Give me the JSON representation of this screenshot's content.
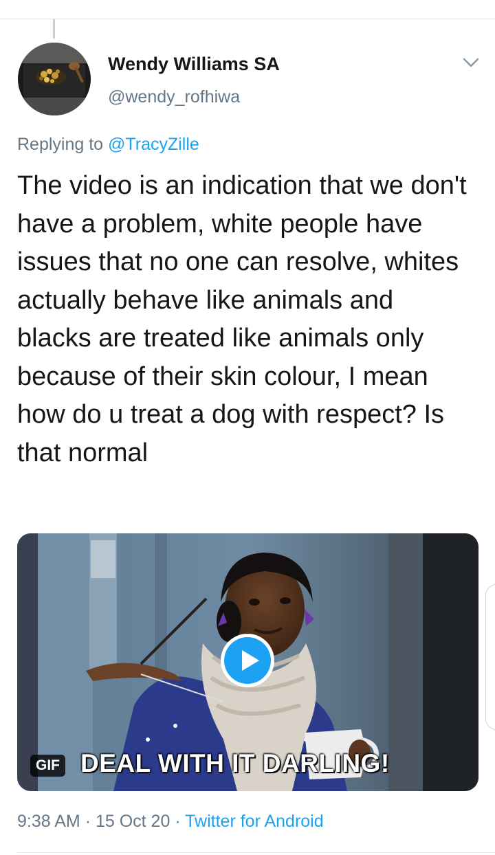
{
  "author": {
    "display_name": "Wendy Williams SA",
    "handle": "@wendy_rofhiwa",
    "avatar_icon": "avatar-food-photo"
  },
  "reply": {
    "prefix": "Replying to",
    "mention": "@TracyZille"
  },
  "tweet": {
    "text": "The video is an indication that we don't have a problem, white people have issues that no one can resolve, whites actually behave like animals and blacks are treated like animals only because of their skin colour, I mean how do u treat a dog with respect? Is that normal"
  },
  "media": {
    "badge": "GIF",
    "caption": "DEAL WITH IT DARLING!",
    "play_icon": "play-icon"
  },
  "meta": {
    "time": "9:38 AM",
    "separator": "·",
    "date": "15 Oct 20",
    "source": "Twitter for Android"
  },
  "colors": {
    "accent": "#1da1f2",
    "secondary_text": "#657786",
    "primary_text": "#14171a",
    "divider": "#e1e8ed"
  }
}
